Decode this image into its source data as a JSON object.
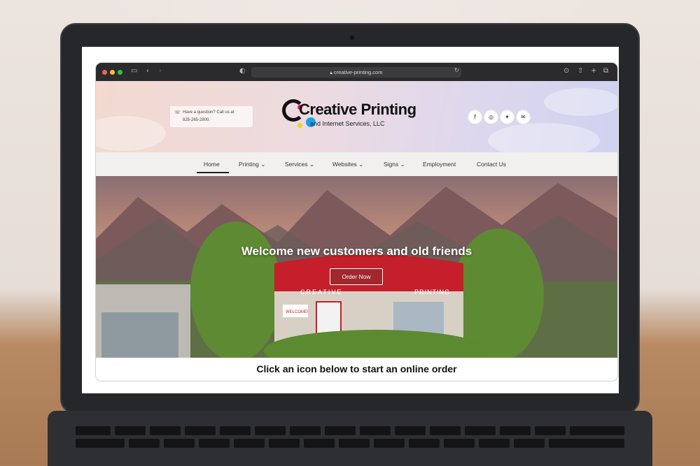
{
  "browser": {
    "url": "creative-printing.com"
  },
  "header": {
    "contact_line1": "Have a question? Call us at",
    "contact_line2": "828-265-2800.",
    "logo_title": "Creative Printing",
    "logo_subtitle": "and Internet Services, LLC"
  },
  "social": [
    "facebook-icon",
    "instagram-icon",
    "twitter-icon",
    "email-icon"
  ],
  "nav": {
    "items": [
      "Home",
      "Printing",
      "Services",
      "Websites",
      "Signs",
      "Employment",
      "Contact Us"
    ],
    "active": "Home"
  },
  "hero": {
    "title": "Welcome new customers and old friends",
    "button": "Order Now",
    "storefront_left": "CREATIVE",
    "storefront_right": "PRINTING",
    "welcome_sign": "WELCOME!"
  },
  "main": {
    "cta_text": "Click an icon below to start an online order"
  },
  "colors": {
    "magenta": "#e0157f",
    "cyan": "#1ba3e8",
    "yellow": "#f4d11a",
    "awning_red": "#c41f2a"
  }
}
